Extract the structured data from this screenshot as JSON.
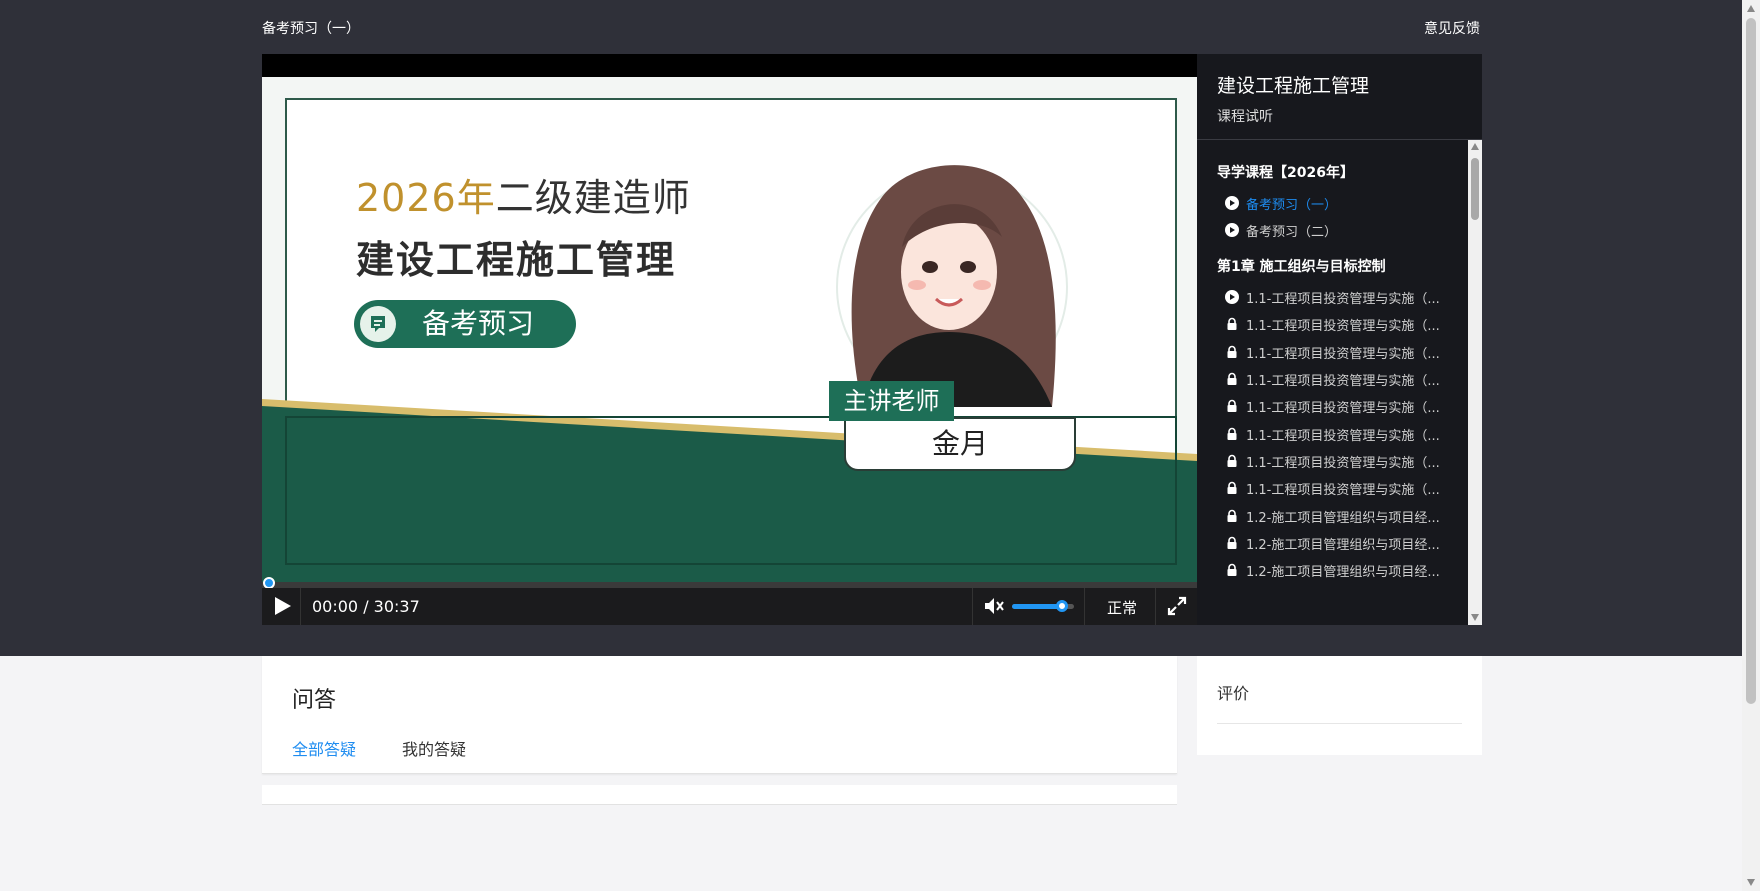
{
  "header": {
    "lesson_title": "备考预习（一）",
    "feedback_label": "意见反馈"
  },
  "player": {
    "slide": {
      "year": "2026年",
      "exam": "二级建造师",
      "subject": "建设工程施工管理",
      "pill_label": "备考预习",
      "teacher_tag": "主讲老师",
      "teacher_name": "金月"
    },
    "time_display": "00:00 / 30:37",
    "progress": 0.0,
    "volume": 0.8,
    "speed_label": "正常",
    "icons": [
      "play-icon",
      "volume-icon",
      "fullscreen-icon"
    ],
    "accent_color": "#2196f3"
  },
  "sidebar": {
    "course_title": "建设工程施工管理",
    "subtitle": "课程试听",
    "chapters": [
      {
        "title": "导学课程【2026年】",
        "lessons": [
          {
            "label": "备考预习（一）",
            "state": "playing"
          },
          {
            "label": "备考预习（二）",
            "state": "available"
          }
        ]
      },
      {
        "title": "第1章 施工组织与目标控制",
        "lessons": [
          {
            "label": "1.1-工程项目投资管理与实施（...",
            "state": "available"
          },
          {
            "label": "1.1-工程项目投资管理与实施（...",
            "state": "locked"
          },
          {
            "label": "1.1-工程项目投资管理与实施（...",
            "state": "locked"
          },
          {
            "label": "1.1-工程项目投资管理与实施（...",
            "state": "locked"
          },
          {
            "label": "1.1-工程项目投资管理与实施（...",
            "state": "locked"
          },
          {
            "label": "1.1-工程项目投资管理与实施（...",
            "state": "locked"
          },
          {
            "label": "1.1-工程项目投资管理与实施（...",
            "state": "locked"
          },
          {
            "label": "1.1-工程项目投资管理与实施（...",
            "state": "locked"
          },
          {
            "label": "1.2-施工项目管理组织与项目经...",
            "state": "locked"
          },
          {
            "label": "1.2-施工项目管理组织与项目经...",
            "state": "locked"
          },
          {
            "label": "1.2-施工项目管理组织与项目经...",
            "state": "locked"
          }
        ]
      }
    ],
    "active_color": "#1e8cf0"
  },
  "qa": {
    "title": "问答",
    "tab_all": "全部答疑",
    "tab_mine": "我的答疑"
  },
  "review": {
    "title": "评价"
  }
}
